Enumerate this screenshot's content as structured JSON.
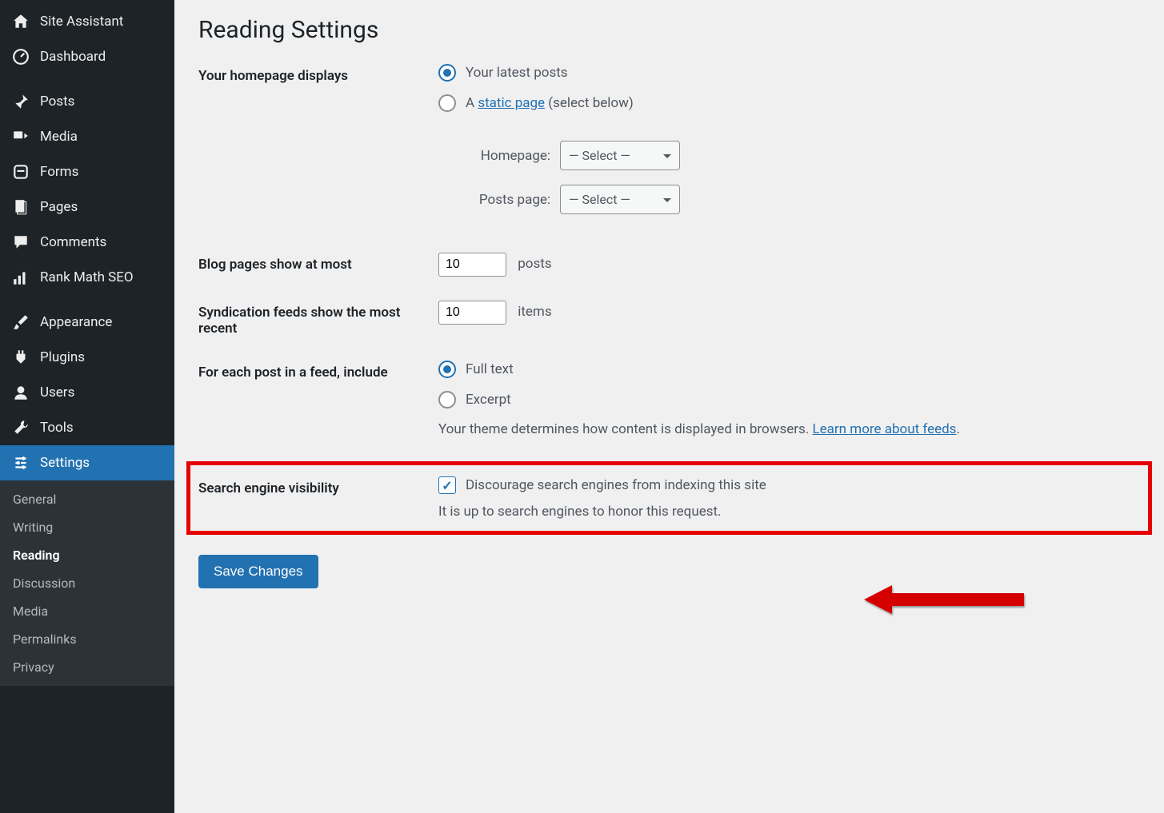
{
  "sidebar": {
    "items": [
      {
        "label": "Site Assistant",
        "icon": "home"
      },
      {
        "label": "Dashboard",
        "icon": "dashboard"
      },
      {
        "label": "Posts",
        "icon": "pin"
      },
      {
        "label": "Media",
        "icon": "media"
      },
      {
        "label": "Forms",
        "icon": "forms"
      },
      {
        "label": "Pages",
        "icon": "pages"
      },
      {
        "label": "Comments",
        "icon": "comments"
      },
      {
        "label": "Rank Math SEO",
        "icon": "seo"
      },
      {
        "label": "Appearance",
        "icon": "brush"
      },
      {
        "label": "Plugins",
        "icon": "plugin"
      },
      {
        "label": "Users",
        "icon": "user"
      },
      {
        "label": "Tools",
        "icon": "wrench"
      },
      {
        "label": "Settings",
        "icon": "settings"
      }
    ],
    "submenu": [
      {
        "label": "General"
      },
      {
        "label": "Writing"
      },
      {
        "label": "Reading"
      },
      {
        "label": "Discussion"
      },
      {
        "label": "Media"
      },
      {
        "label": "Permalinks"
      },
      {
        "label": "Privacy"
      }
    ]
  },
  "page": {
    "title": "Reading Settings",
    "homepage_label": "Your homepage displays",
    "homepage_opt1": "Your latest posts",
    "homepage_opt2_prefix": "A ",
    "homepage_opt2_link": "static page",
    "homepage_opt2_suffix": " (select below)",
    "homepage_select_label": "Homepage:",
    "posts_page_select_label": "Posts page:",
    "select_placeholder": "— Select —",
    "blog_pages_label": "Blog pages show at most",
    "blog_pages_value": "10",
    "blog_pages_unit": "posts",
    "syndication_label": "Syndication feeds show the most recent",
    "syndication_value": "10",
    "syndication_unit": "items",
    "feed_label": "For each post in a feed, include",
    "feed_opt1": "Full text",
    "feed_opt2": "Excerpt",
    "feed_desc_prefix": "Your theme determines how content is displayed in browsers. ",
    "feed_desc_link": "Learn more about feeds",
    "visibility_label": "Search engine visibility",
    "visibility_checkbox_label": "Discourage search engines from indexing this site",
    "visibility_desc": "It is up to search engines to honor this request.",
    "save_label": "Save Changes"
  }
}
